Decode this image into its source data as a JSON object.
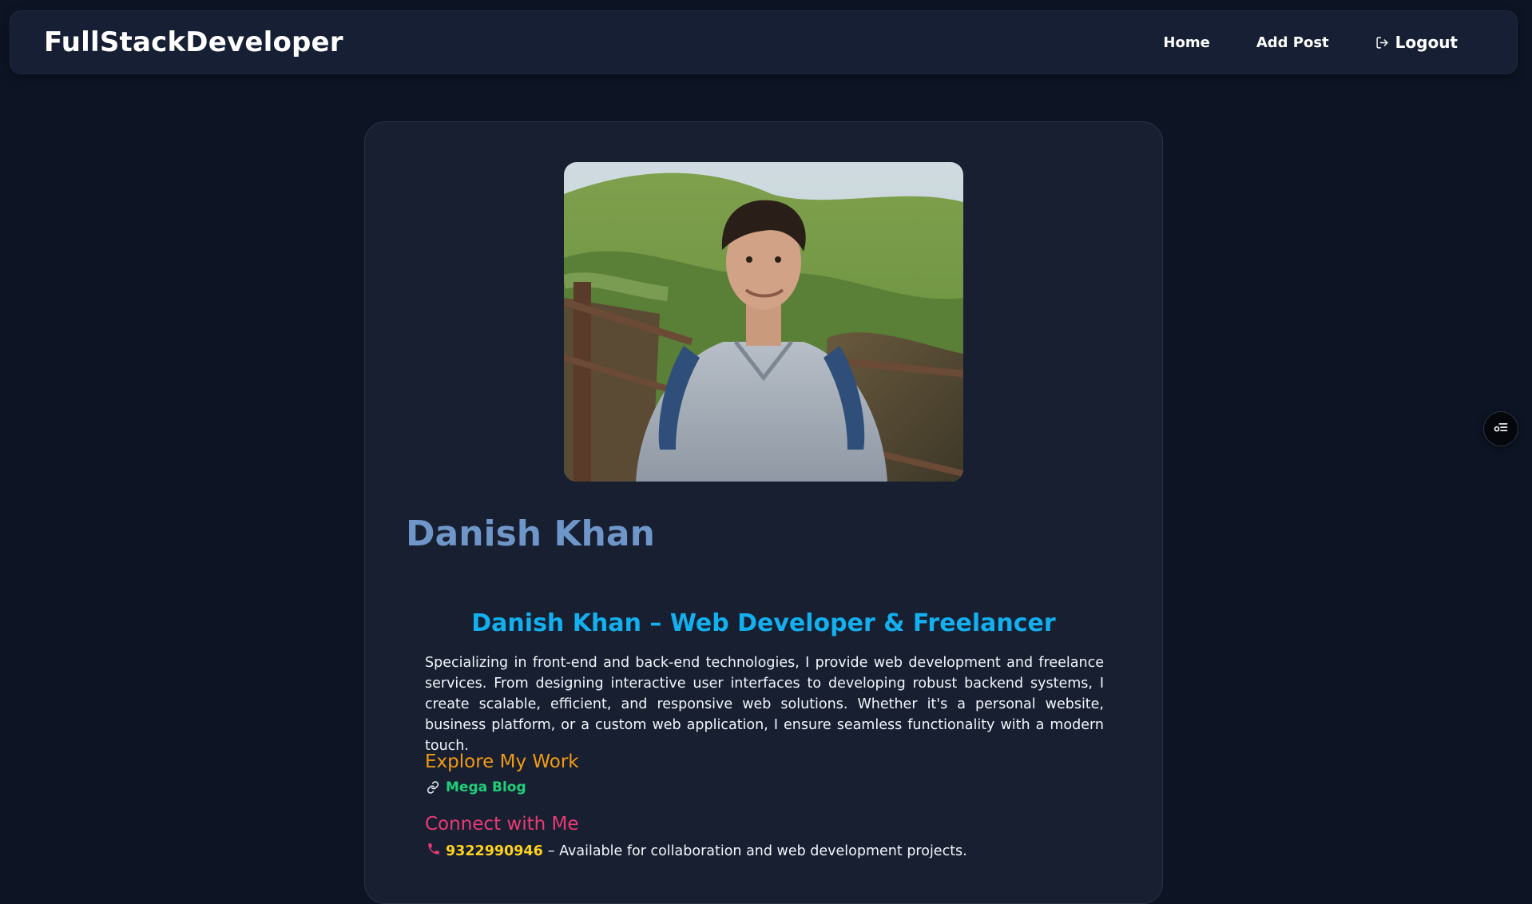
{
  "navbar": {
    "brand": "FullStackDeveloper",
    "links": {
      "home": "Home",
      "add_post": "Add Post",
      "logout": "Logout"
    },
    "logout_icon": "logout-icon"
  },
  "profile": {
    "photo_icon": "profile-photo",
    "name": "Danish Khan",
    "bio_heading": "Danish Khan – Web Developer & Freelancer",
    "bio_text": "Specializing in front-end and back-end technologies, I provide web development and freelance services. From designing interactive user interfaces to developing robust backend systems, I create scalable, efficient, and responsive web solutions. Whether it's a personal website, business platform, or a custom web application, I ensure seamless functionality with a modern touch.",
    "explore": {
      "heading": "Explore My Work",
      "link_icon": "link-icon",
      "link_label": "Mega Blog"
    },
    "connect": {
      "heading": "Connect with Me",
      "phone_icon": "phone-icon",
      "phone": "9322990946",
      "note": " – Available for collaboration and web development projects."
    }
  },
  "floating_button": {
    "icon": "toggle-settings-icon"
  },
  "colors": {
    "background": "#0d1424",
    "navbar": "#161f33",
    "card": "#171f31",
    "name": "#6f96c9",
    "bio_heading": "#13b0f0",
    "explore_heading": "#f49a12",
    "work_link": "#1fd078",
    "connect_heading": "#ec3a74",
    "phone": "#ffd21f"
  }
}
